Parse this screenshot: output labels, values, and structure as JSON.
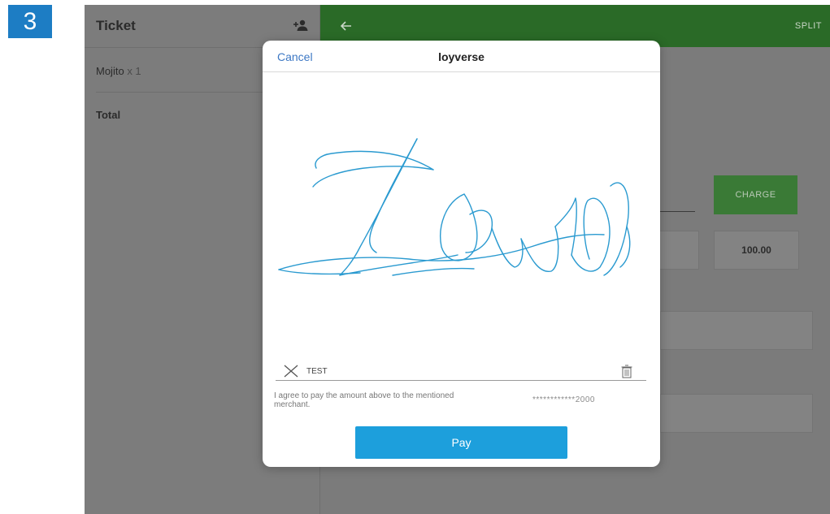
{
  "step_number": "3",
  "ticket": {
    "title": "Ticket",
    "item_name": "Mojito",
    "item_qty": "x 1",
    "total_label": "Total"
  },
  "payment": {
    "split_label": "SPLIT",
    "charge_label": "CHARGE",
    "cash_amount": "100.00",
    "header_color": "#2a6a27"
  },
  "modal": {
    "cancel_label": "Cancel",
    "title": "loyverse",
    "signer_name": "TEST",
    "agreement_text": "I agree to pay the amount above to the mentioned merchant.",
    "card_number": "************2000",
    "pay_label": "Pay",
    "pay_color": "#1d9fdc",
    "signature_color": "#2a9ad0"
  },
  "icons": {
    "add_customer": "add-person-icon",
    "back": "back-arrow-icon",
    "clear": "close-x-icon",
    "delete": "trash-icon"
  }
}
